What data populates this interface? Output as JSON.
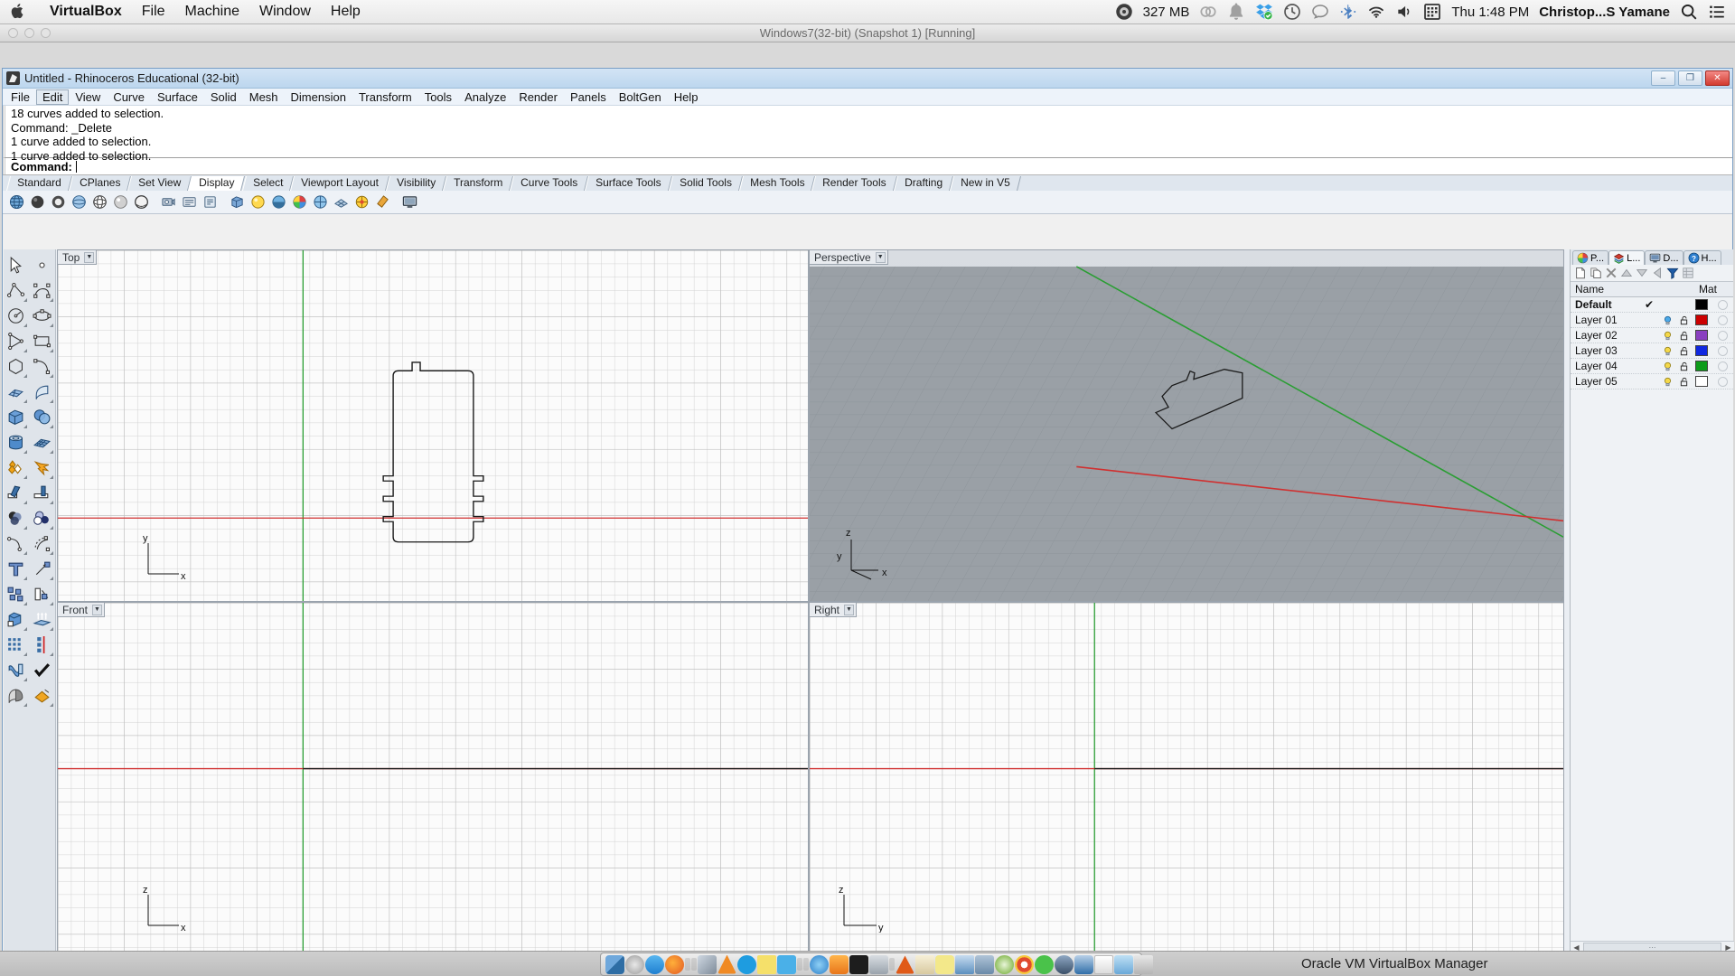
{
  "mac_menubar": {
    "apple_icon": "apple-icon",
    "app_name": "VirtualBox",
    "menus": [
      "File",
      "Machine",
      "Window",
      "Help"
    ],
    "memory": "327 MB",
    "clock": "Thu 1:48 PM",
    "user": "Christop...S Yamane",
    "status_icons": [
      "istat-menu-icon",
      "creative-cloud-icon",
      "notification-bell-icon",
      "dropbox-icon",
      "time-machine-icon",
      "messages-icon",
      "bluetooth-icon",
      "wifi-icon",
      "volume-icon",
      "calendar-icon"
    ],
    "right_icons": [
      "spotlight-search-icon",
      "notification-center-icon"
    ]
  },
  "vm_window": {
    "title": "Windows7(32-bit) (Snapshot 1) [Running]",
    "traffic_lights": [
      "close",
      "minimize",
      "zoom"
    ]
  },
  "rhino": {
    "title": "Untitled - Rhinoceros Educational (32-bit)",
    "window_buttons": {
      "minimize": "–",
      "maximize": "❐",
      "close": "✕"
    },
    "menus": [
      "File",
      "Edit",
      "View",
      "Curve",
      "Surface",
      "Solid",
      "Mesh",
      "Dimension",
      "Transform",
      "Tools",
      "Analyze",
      "Render",
      "Panels",
      "BoltGen",
      "Help"
    ],
    "active_menu": "Edit",
    "command_history": [
      "18 curves added to selection.",
      "Command: _Delete",
      "1 curve added to selection.",
      "1 curve added to selection."
    ],
    "command_prompt": "Command:",
    "command_input_value": "",
    "toolbar_tabs": [
      "Standard",
      "CPlanes",
      "Set View",
      "Display",
      "Select",
      "Viewport Layout",
      "Visibility",
      "Transform",
      "Curve Tools",
      "Surface Tools",
      "Solid Tools",
      "Mesh Tools",
      "Render Tools",
      "Drafting",
      "New in V5"
    ],
    "active_toolbar_tab": "Display",
    "toolbar_icons": [
      "globe-icon",
      "sphere-shaded-icon",
      "sphere-ghosted-icon",
      "sphere-xray-icon",
      "sphere-wireframe-icon",
      "sphere-rendered-icon",
      "sphere-technical-icon",
      "camera-icon",
      "view-named-icon",
      "view-props-icon",
      "box-display-icon",
      "shade-sphere-icon",
      "render-preview-icon",
      "color-wheel-icon",
      "globe-grid-icon",
      "render-mesh-icon",
      "display-options-icon",
      "flashlight-icon",
      "monitor-icon"
    ],
    "left_toolbar_icons": [
      "select-arrow-icon",
      "point-icon",
      "polyline-icon",
      "curve-interp-icon",
      "circle-icon",
      "ellipse-icon",
      "polygon-triangle-icon",
      "rectangle-icon",
      "polygon-icon",
      "arc-icon",
      "surface-srfpt-icon",
      "surface-extrude-icon",
      "box-solid-icon",
      "sphere-solid-icon",
      "cylinder-icon",
      "mesh-plane-icon",
      "boolean-union-icon",
      "explode-icon",
      "trim-icon",
      "split-icon",
      "boolean-sphere-icon",
      "boolean-difference-icon",
      "fillet-icon",
      "blend-curve-icon",
      "text-icon",
      "dimension-leader-icon",
      "copy-objects-icon",
      "rotate-object-icon",
      "offset-surface-icon",
      "extrude-arrows-icon",
      "array-grid-icon",
      "array-linear-icon",
      "bend-icon",
      "check-object-icon",
      "shade-preview-icon",
      "paint-bucket-icon"
    ],
    "viewports": [
      {
        "name": "Top",
        "cplane_axes": [
          "y",
          "x"
        ]
      },
      {
        "name": "Perspective",
        "cplane_axes": [
          "z",
          "y",
          "x"
        ]
      },
      {
        "name": "Front",
        "cplane_axes": [
          "z",
          "x"
        ]
      },
      {
        "name": "Right",
        "cplane_axes": [
          "z",
          "y"
        ]
      }
    ],
    "viewport_tabs": [
      "Perspective",
      "Top",
      "Front",
      "Right"
    ],
    "active_viewport_tab": "Top",
    "add_viewport_tab_icon": "add-viewport-icon",
    "panel_tabs": [
      {
        "label": "P...",
        "icon": "properties-icon"
      },
      {
        "label": "L...",
        "icon": "layers-icon"
      },
      {
        "label": "D...",
        "icon": "display-icon"
      },
      {
        "label": "H...",
        "icon": "help-icon"
      }
    ],
    "active_panel_tab": "L...",
    "panel_toolbar_icons": [
      "new-layer-icon",
      "copy-layer-icon",
      "delete-layer-icon",
      "move-up-icon",
      "move-down-icon",
      "move-left-icon",
      "filter-icon",
      "properties-grid-icon"
    ],
    "layer_columns": [
      "Name",
      "Mat"
    ],
    "layers": [
      {
        "name": "Default",
        "current": true,
        "visible": null,
        "locked": null,
        "color": "#000000"
      },
      {
        "name": "Layer 01",
        "current": false,
        "visible": true,
        "locked": false,
        "color": "#cc0000"
      },
      {
        "name": "Layer 02",
        "current": false,
        "visible": true,
        "locked": false,
        "color": "#8a3fc0"
      },
      {
        "name": "Layer 03",
        "current": false,
        "visible": true,
        "locked": false,
        "color": "#1028e0"
      },
      {
        "name": "Layer 04",
        "current": false,
        "visible": true,
        "locked": false,
        "color": "#0d9b1a"
      },
      {
        "name": "Layer 05",
        "current": false,
        "visible": true,
        "locked": false,
        "color": "#ffffff"
      }
    ],
    "current_layer_check": "✔",
    "scroll_left_arrow": "◀",
    "scroll_right_arrow": "▶",
    "scroll_grip": "⋯"
  },
  "host": {
    "status_label": "Oracle VM VirtualBox Manager",
    "dock_items": [
      "finder-icon",
      "launchpad-icon",
      "appstore-icon",
      "firefox-icon",
      "sep1",
      "sep2",
      "photos-icon",
      "vlc-icon",
      "skype-icon",
      "stickies-icon",
      "word-icon",
      "sep3",
      "sep4",
      "itunes-icon",
      "ibooks-icon",
      "activity-icon",
      "preview-icon",
      "sep5",
      "illustrator-icon",
      "notes-icon",
      "textedit-icon",
      "reader-icon",
      "utility-icon",
      "settings-icon",
      "chrome-icon",
      "spotify-icon",
      "rhino-icon",
      "vbox-icon",
      "doc-icon",
      "downloads-folder-icon",
      "trash-icon"
    ]
  },
  "colors": {
    "axis_green": "#2a9e33",
    "axis_red": "#d03030",
    "grid_line": "#c8c8c8",
    "persp_bg": "#9aa0a6",
    "viewport_bg": "#fbfbfb",
    "rhino_title_bg": "#bcd6ee"
  }
}
